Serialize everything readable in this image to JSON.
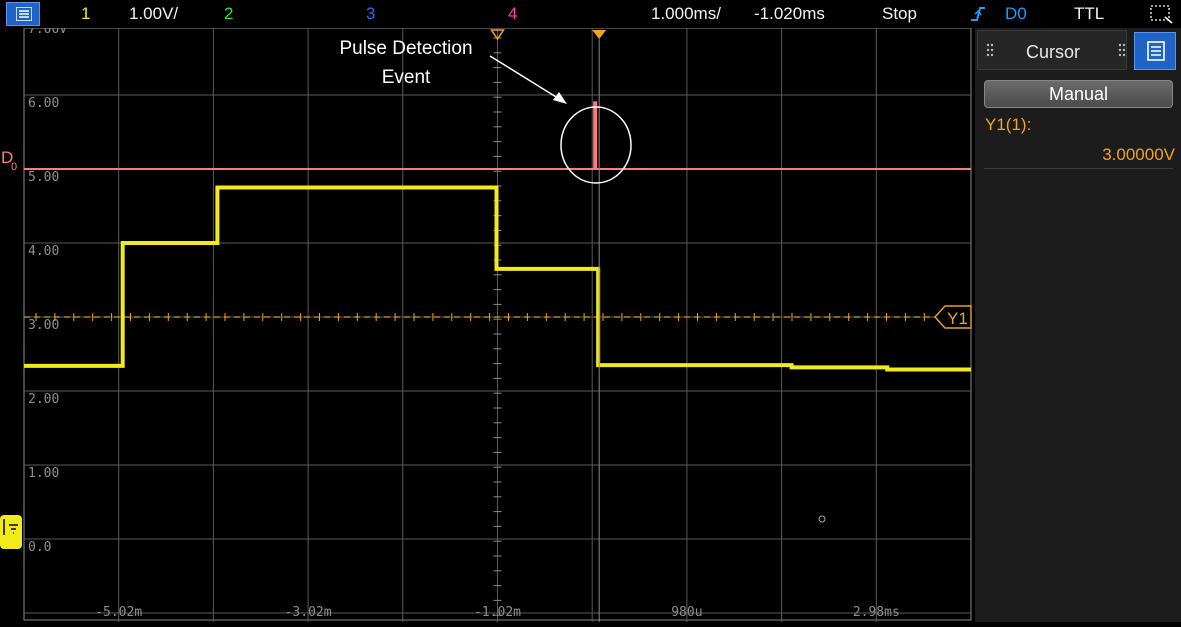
{
  "topbar": {
    "ch1_num": "1",
    "ch1_scale": "1.00V/",
    "ch2_num": "2",
    "ch3_num": "3",
    "ch4_num": "4",
    "timebase": "1.000ms/",
    "delay": "-1.020ms",
    "run_state": "Stop",
    "trigger_icon": "trigger-edge-icon",
    "trigger_source": "D0",
    "trigger_level": "TTL"
  },
  "display": {
    "y_labels": [
      "7.00V",
      "6.00",
      "5.00",
      "4.00",
      "3.00",
      "2.00",
      "1.00",
      "0.0"
    ],
    "x_labels": [
      "-5.02m",
      "-3.02m",
      "-1.02m",
      "980u",
      "2.98ms"
    ],
    "digital_label": "D",
    "digital_sub": "0",
    "cursor_label": "Y1",
    "annotation_line1": "Pulse Detection",
    "annotation_line2": "Event"
  },
  "side_panel": {
    "tab_label": "Cursor",
    "mode_button": "Manual",
    "y1_label": "Y1(1):",
    "y1_value": "3.00000V"
  },
  "colors": {
    "ch1": "#f2ea1a",
    "ch2": "#2ee62e",
    "ch3": "#3b5cff",
    "ch4": "#ff3fb0",
    "digital": "#ff7a7a",
    "cursor": "#f0a31c",
    "trigger": "#1e9bff"
  },
  "chart_data": {
    "type": "line",
    "x_unit": "ms",
    "y_unit": "V",
    "xlim": [
      -5.77,
      3.73
    ],
    "ylim": [
      -0.25,
      7.0
    ],
    "series": [
      {
        "name": "1",
        "x": [
          -5.77,
          -4.78,
          -4.78,
          -3.83,
          -3.83,
          -1.03,
          -1.03,
          -0.01,
          -0.01,
          1.93,
          1.93,
          2.89,
          2.89,
          3.73
        ],
        "y": [
          2.34,
          2.34,
          4.0,
          4.0,
          4.75,
          4.75,
          3.65,
          3.65,
          2.35,
          2.35,
          2.32,
          2.32,
          2.29,
          2.29
        ]
      },
      {
        "name": "D0",
        "x": [
          -5.77,
          -0.05,
          -0.05,
          -0.03,
          -0.03,
          3.73
        ],
        "y": [
          5.0,
          5.0,
          5.9,
          5.9,
          5.0,
          5.0
        ]
      }
    ],
    "cursor_y1": 3.0
  }
}
